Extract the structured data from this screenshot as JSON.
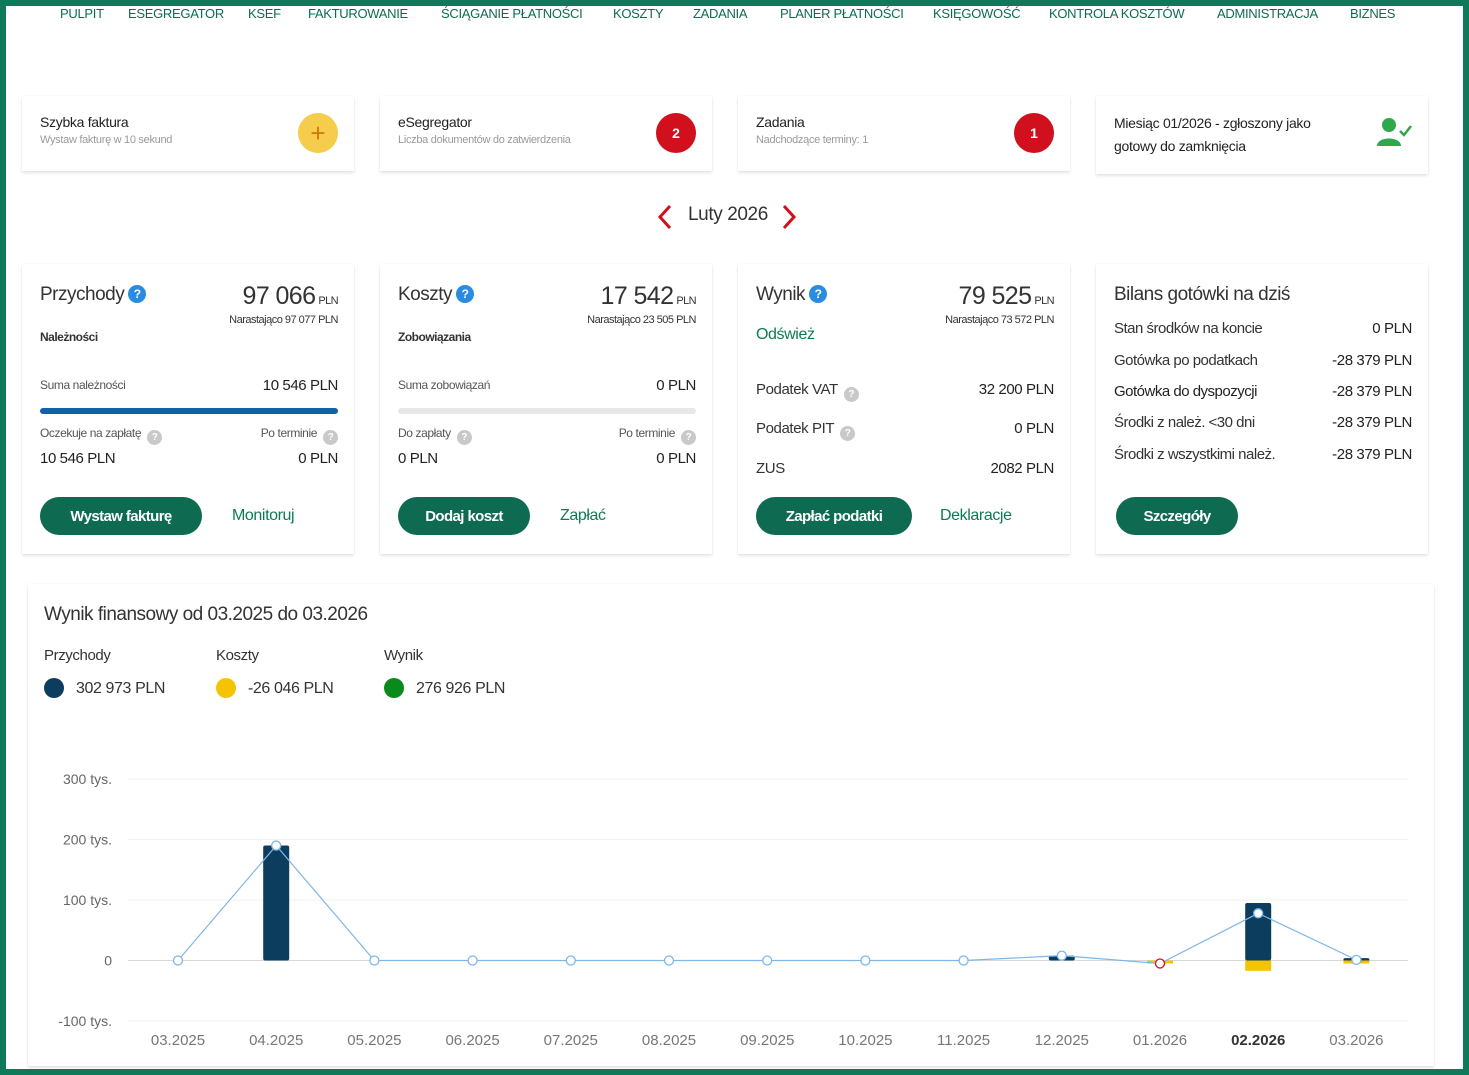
{
  "nav": [
    "PULPIT",
    "ESEGREGATOR",
    "KSEF",
    "FAKTUROWANIE",
    "ŚCIĄGANIE PŁATNOŚCI",
    "KOSZTY",
    "ZADANIA",
    "PLANER PŁATNOŚCI",
    "KSIĘGOWOŚĆ",
    "KONTROLA KOSZTÓW",
    "ADMINISTRACJA",
    "BIZNES"
  ],
  "top_cards": {
    "quick_invoice": {
      "title": "Szybka faktura",
      "subtitle": "Wystaw fakturę w 10 sekund",
      "icon": "+"
    },
    "esegregator": {
      "title": "eSegregator",
      "subtitle": "Liczba dokumentów do zatwierdzenia",
      "badge": "2"
    },
    "tasks": {
      "title": "Zadania",
      "subtitle": "Nadchodzące terminy: 1",
      "badge": "1"
    },
    "month_closed": {
      "text": "Miesiąc 01/2026 - zgłoszony jako gotowy do zamknięcia",
      "icon": "user-check-icon"
    }
  },
  "month_selector": {
    "label": "Luty 2026",
    "prev": "❮",
    "next": "❯"
  },
  "revenue": {
    "title": "Przychody",
    "help": "?",
    "amount": "97 066",
    "unit": "PLN",
    "cumulative": "Narastająco 97 077 PLN",
    "subhead": "Należności",
    "sum_label": "Suma należności",
    "sum_value": "10 546 PLN",
    "progress": 1.0,
    "pending_label": "Oczekuje na zapłatę",
    "pending_value": "10 546 PLN",
    "overdue_label": "Po terminie",
    "overdue_value": "0 PLN",
    "button": "Wystaw fakturę",
    "link": "Monitoruj"
  },
  "costs": {
    "title": "Koszty",
    "help": "?",
    "amount": "17 542",
    "unit": "PLN",
    "cumulative": "Narastająco 23 505 PLN",
    "subhead": "Zobowiązania",
    "sum_label": "Suma zobowiązań",
    "sum_value": "0 PLN",
    "progress": 0.0,
    "due_label": "Do zapłaty",
    "due_value": "0 PLN",
    "overdue_label": "Po terminie",
    "overdue_value": "0 PLN",
    "button": "Dodaj koszt",
    "link": "Zapłać"
  },
  "result": {
    "title": "Wynik",
    "help": "?",
    "amount": "79 525",
    "unit": "PLN",
    "cumulative": "Narastająco 73 572 PLN",
    "refresh": "Odśwież",
    "vat_label": "Podatek VAT",
    "vat_value": "32 200 PLN",
    "pit_label": "Podatek PIT",
    "pit_value": "0 PLN",
    "zus_label": "ZUS",
    "zus_value": "2082 PLN",
    "button": "Zapłać podatki",
    "link": "Deklaracje"
  },
  "cash": {
    "title": "Bilans gotówki na dziś",
    "rows": [
      {
        "label": "Stan środków na koncie",
        "value": "0 PLN"
      },
      {
        "label": "Gotówka po podatkach",
        "value": "-28 379 PLN"
      },
      {
        "label": "Gotówka do dyspozycji",
        "value": "-28 379 PLN"
      },
      {
        "label": "Środki z należ. <30 dni",
        "value": "-28 379 PLN"
      },
      {
        "label": "Środki z wszystkimi należ.",
        "value": "-28 379 PLN"
      }
    ],
    "button": "Szczegóły"
  },
  "finance": {
    "title": "Wynik finansowy od 03.2025 do 03.2026",
    "legend": [
      {
        "name": "Przychody",
        "value": "302 973 PLN",
        "color": "#0d3d5e"
      },
      {
        "name": "Koszty",
        "value": "-26 046 PLN",
        "color": "#f5c400"
      },
      {
        "name": "Wynik",
        "value": "276 926 PLN",
        "color": "#0a8a1a"
      }
    ]
  },
  "chart_data": {
    "type": "bar",
    "categories": [
      "03.2025",
      "04.2025",
      "05.2025",
      "06.2025",
      "07.2025",
      "08.2025",
      "09.2025",
      "10.2025",
      "11.2025",
      "12.2025",
      "01.2026",
      "02.2026",
      "03.2026"
    ],
    "series": [
      {
        "name": "Przychody",
        "values": [
          0,
          190000,
          0,
          0,
          0,
          0,
          0,
          0,
          0,
          8000,
          0,
          95000,
          4000
        ],
        "color": "#0d3d5e"
      },
      {
        "name": "Koszty",
        "values": [
          0,
          0,
          0,
          0,
          0,
          0,
          0,
          0,
          0,
          0,
          -5000,
          -17000,
          -3000
        ],
        "color": "#f5c400"
      },
      {
        "name": "Wynik",
        "values": [
          0,
          190000,
          0,
          0,
          0,
          0,
          0,
          0,
          0,
          8000,
          -5000,
          78000,
          1000
        ],
        "color": "#7fb6e8"
      }
    ],
    "y_ticks": [
      "300 tys.",
      "200 tys.",
      "100 tys.",
      "0",
      "-100 tys."
    ],
    "y_tick_values": [
      300000,
      200000,
      100000,
      0,
      -100000
    ],
    "ylim": [
      -100000,
      300000
    ],
    "highlight_category": "02.2026",
    "grid": true
  }
}
